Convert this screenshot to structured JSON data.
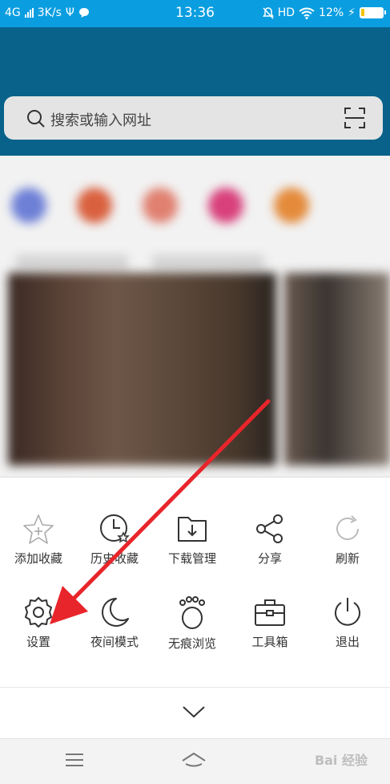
{
  "status_bar": {
    "network": "4G",
    "speed": "3K/s",
    "time": "13:36",
    "hd": "HD",
    "battery": "12%",
    "colors": {
      "background": "#0a9ee0"
    }
  },
  "search": {
    "placeholder": "搜索或输入网址",
    "icon": "search-icon",
    "scan_icon": "scan-icon"
  },
  "menu": {
    "row1": [
      {
        "label": "添加收藏",
        "icon": "star-add-icon"
      },
      {
        "label": "历史收藏",
        "icon": "clock-star-icon"
      },
      {
        "label": "下载管理",
        "icon": "folder-download-icon"
      },
      {
        "label": "分享",
        "icon": "share-icon"
      },
      {
        "label": "刷新",
        "icon": "refresh-icon"
      }
    ],
    "row2": [
      {
        "label": "设置",
        "icon": "gear-icon"
      },
      {
        "label": "夜间模式",
        "icon": "moon-icon"
      },
      {
        "label": "无痕浏览",
        "icon": "paw-icon"
      },
      {
        "label": "工具箱",
        "icon": "toolbox-icon"
      },
      {
        "label": "退出",
        "icon": "power-icon"
      }
    ],
    "collapse_icon": "chevron-down-icon"
  },
  "navbar": {
    "menu_icon": "hamburger-icon",
    "home_icon": "home-icon",
    "watermark": "Bai 经验"
  },
  "annotation": {
    "arrow_color": "#e8252b"
  }
}
